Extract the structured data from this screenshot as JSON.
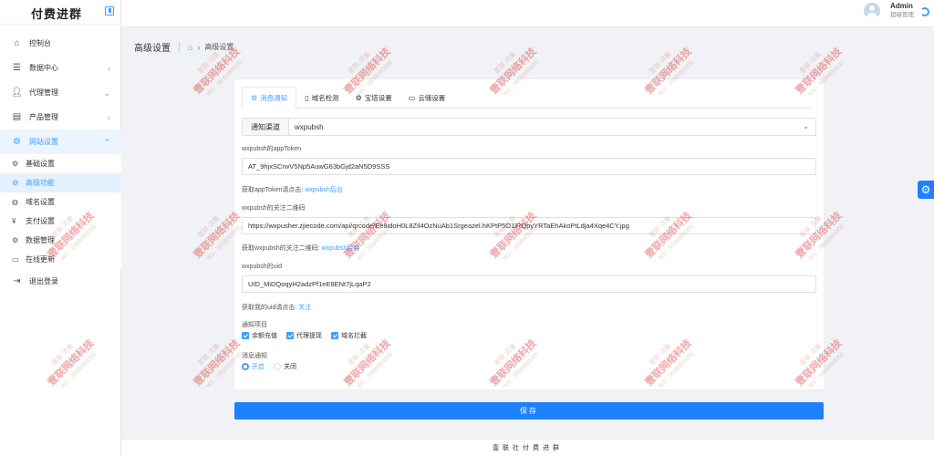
{
  "app": {
    "title": "付费进群"
  },
  "header": {
    "user_name": "Admin",
    "user_role": "超级管理"
  },
  "sidebar": {
    "items": [
      {
        "label": "控制台",
        "icon": "home-icon"
      },
      {
        "label": "数据中心",
        "icon": "chart-icon"
      },
      {
        "label": "代理管理",
        "icon": "user-icon"
      },
      {
        "label": "产品管理",
        "icon": "product-icon"
      },
      {
        "label": "网站设置",
        "icon": "gear-icon"
      }
    ],
    "sub_items": [
      {
        "label": "基础设置",
        "icon": "gear-icon"
      },
      {
        "label": "高级功能",
        "icon": "gear-icon"
      },
      {
        "label": "域名设置",
        "icon": "globe-icon"
      },
      {
        "label": "支付设置",
        "icon": "yen-icon"
      },
      {
        "label": "数据管理",
        "icon": "gear-icon"
      },
      {
        "label": "在线更新",
        "icon": "update-icon"
      }
    ],
    "logout": "退出登录"
  },
  "breadcrumb": {
    "title": "高级设置",
    "current": "高级设置"
  },
  "tabs": [
    {
      "label": "消息通知"
    },
    {
      "label": "域名检测"
    },
    {
      "label": "宝塔设置"
    },
    {
      "label": "云储设置"
    }
  ],
  "form": {
    "channel_label": "通知渠道",
    "channel_value": "wxpubsh",
    "token_label": "wxpubsh的appToken",
    "token_value": "AT_9hjxSCrwV5Np5AuwG63bGjd2aN5D9SSS",
    "token_hint": "获取appToken请点击:",
    "token_link": "wxpubsh后台",
    "qr_label": "wxpubsh的关注二维码",
    "qr_value": "https://wxpusher.zjiecode.com/api/qrcode/Ee8idoH0L8Zil4OzNuAb1Srgeazel.hKPtP5O1lRQpyYRTaEhAkoPtLdja4Xqe4CY.jpg",
    "qr_hint": "获取wxpubsh的关注二维码:",
    "qr_link": "wxpubsh后台",
    "uid_label": "wxpubsh的uid",
    "uid_value": "UID_MiDQoqyH2adzPf1eE8ENt7jLqaP2",
    "uid_hint": "获取我的uid请点击:",
    "uid_link": "关注",
    "notify_items_label": "通知项目",
    "checks": [
      {
        "label": "余额充值"
      },
      {
        "label": "代理提现"
      },
      {
        "label": "域名拦截"
      }
    ],
    "message_label": "消息通知",
    "radios": [
      {
        "label": "开启",
        "selected": true
      },
      {
        "label": "关闭",
        "selected": false
      }
    ]
  },
  "save_label": "保存",
  "footer": "壹联社付费进群",
  "watermark": {
    "top": "壹联·流量",
    "main": "壹联网络科技",
    "bottom": "Wx：9898880005"
  }
}
